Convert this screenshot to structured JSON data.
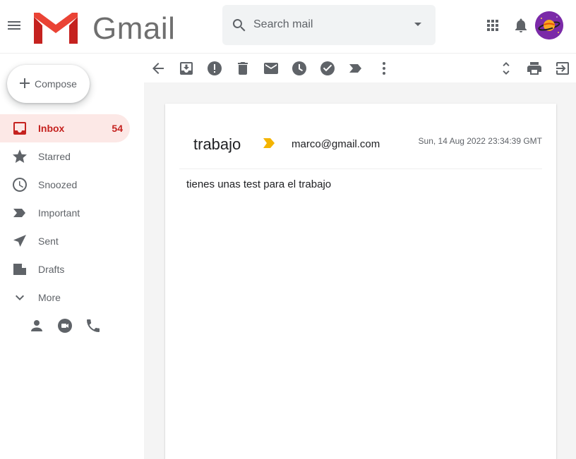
{
  "header": {
    "logo_text": "Gmail",
    "search": {
      "placeholder": "Search mail"
    },
    "icons": [
      "menu-icon",
      "search-icon",
      "dropdown-icon",
      "apps-icon",
      "bell-icon"
    ]
  },
  "sidebar": {
    "compose_label": "Compose",
    "items": [
      {
        "label": "Inbox",
        "icon": "inbox-icon",
        "count": "54",
        "active": true
      },
      {
        "label": "Starred",
        "icon": "star-icon"
      },
      {
        "label": "Snoozed",
        "icon": "clock-icon"
      },
      {
        "label": "Important",
        "icon": "important-icon"
      },
      {
        "label": "Sent",
        "icon": "send-icon"
      },
      {
        "label": "Drafts",
        "icon": "draft-icon"
      },
      {
        "label": "More",
        "icon": "chevron-down-icon"
      }
    ],
    "bottom_icons": [
      "person-icon",
      "video-icon",
      "phone-icon"
    ]
  },
  "toolbar": {
    "icons": [
      "back-arrow-icon",
      "archive-icon",
      "report-spam-icon",
      "delete-icon",
      "mark-unread-icon",
      "snooze-icon",
      "done-icon",
      "label-icon",
      "more-vert-icon",
      "expand-icon",
      "print-icon",
      "open-new-window-icon"
    ]
  },
  "message": {
    "subject": "trabajo",
    "sender": "marco@gmail.com",
    "date": "Sun, 14 Aug 2022 23:34:39 GMT",
    "body": "tienes unas test para el trabajo"
  },
  "colors": {
    "accent_red": "#c5221f",
    "active_bg": "#fce8e6",
    "important_marker": "#f4b400",
    "icon_gray": "#5f6368"
  }
}
